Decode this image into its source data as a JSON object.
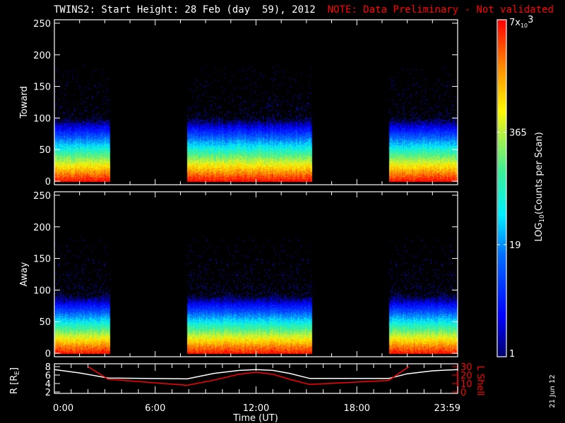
{
  "title": {
    "main": "TWINS2: Start Height: 28 Feb (day  59), 2012",
    "note": "NOTE: Data Preliminary - Not validated"
  },
  "date_stamp": "21 Jun 12",
  "colors": {
    "note": "#ff0000",
    "axes": "#ffffff",
    "lshell": "#ff0000",
    "radius": "#ffffff"
  },
  "chart_data": [
    {
      "type": "heatmap",
      "name": "toward",
      "ylabel": "Toward",
      "ylim": [
        0,
        255
      ],
      "yticks": [
        "0",
        "50",
        "100",
        "150",
        "200",
        "250"
      ],
      "ytick_values": [
        0,
        50,
        100,
        150,
        200,
        250
      ],
      "xlim_hours": [
        0,
        24
      ],
      "coverage_hours": [
        [
          0,
          3.3
        ],
        [
          7.9,
          15.3
        ],
        [
          19.9,
          24
        ]
      ],
      "max_log_counts": 3.85,
      "falloff_per_unit": 0.04
    },
    {
      "type": "heatmap",
      "name": "away",
      "ylabel": "Away",
      "ylim": [
        0,
        255
      ],
      "yticks": [
        "0",
        "50",
        "100",
        "150",
        "200",
        "250"
      ],
      "ytick_values": [
        0,
        50,
        100,
        150,
        200,
        250
      ],
      "xlim_hours": [
        0,
        24
      ],
      "coverage_hours": [
        [
          0,
          3.3
        ],
        [
          7.9,
          15.3
        ],
        [
          19.9,
          24
        ]
      ],
      "max_log_counts": 3.8,
      "falloff_per_unit": 0.043
    },
    {
      "type": "line",
      "name": "orbit",
      "ylabel_left": "R [R",
      "ylabel_left_sub": "E",
      "ylabel_left_end": "]",
      "ylabel_right": "L Shell",
      "ylim_left": [
        2,
        8
      ],
      "ylim_right": [
        0,
        30
      ],
      "yticks_left": [
        "8",
        "6",
        "4",
        "2"
      ],
      "yticks_left_values": [
        8,
        6,
        4,
        2
      ],
      "yticks_right": [
        "30",
        "20",
        "10",
        "0"
      ],
      "yticks_right_values": [
        30,
        20,
        10,
        0
      ],
      "xlabel": "Time (UT)",
      "xticks": [
        "0:00",
        "6:00",
        "12:00",
        "18:00",
        "23:59"
      ],
      "xtick_values": [
        0,
        6,
        12,
        18,
        24
      ],
      "series": [
        {
          "name": "R",
          "axis": "left",
          "x": [
            0,
            1.5,
            3.2,
            7.9,
            9.5,
            11,
            12,
            13,
            14,
            15.2,
            19.9,
            21,
            22.5,
            24
          ],
          "y": [
            7.3,
            6.5,
            5.3,
            5.1,
            6.4,
            7.1,
            7.3,
            7.1,
            6.4,
            5.2,
            5.2,
            6.3,
            7.0,
            7.3
          ]
        },
        {
          "name": "L Shell",
          "axis": "right",
          "x": [
            2.0,
            3.2,
            7.9,
            9.5,
            11,
            12,
            13,
            14,
            15.2,
            19.9,
            21.1
          ],
          "y": [
            30,
            15.1,
            7.9,
            14,
            21,
            23.3,
            21,
            15,
            8.9,
            13.7,
            30
          ]
        }
      ]
    },
    {
      "type": "colorbar",
      "name": "colorbar",
      "label": "LOG",
      "label_sub": "10",
      "label_end": "(Counts per Scan)",
      "ticks": [
        {
          "label": "7x",
          "sub": "10",
          "sup": "3",
          "value": 7000
        },
        {
          "label": "365",
          "value": 365
        },
        {
          "label": "19",
          "value": 19
        },
        {
          "label": "1",
          "value": 1
        }
      ],
      "range": [
        1,
        7000
      ]
    }
  ]
}
